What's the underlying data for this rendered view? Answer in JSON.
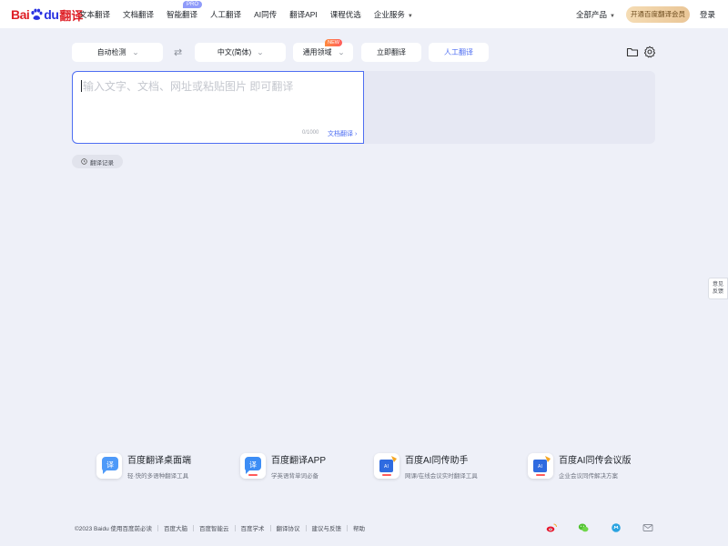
{
  "brand": {
    "bai": "Bai",
    "du": "du",
    "fanyi": "翻译"
  },
  "nav": {
    "items": [
      {
        "label": "文本翻译"
      },
      {
        "label": "文档翻译"
      },
      {
        "label": "智能翻译",
        "badge": "PRO"
      },
      {
        "label": "人工翻译"
      },
      {
        "label": "AI同传"
      },
      {
        "label": "翻译API"
      },
      {
        "label": "课程优选"
      },
      {
        "label": "企业服务"
      }
    ],
    "all_products": "全部产品",
    "vip": "开通百度翻译会员",
    "login": "登录"
  },
  "toolbar": {
    "source_lang": "自动检测",
    "target_lang": "中文(简体)",
    "domain": "通用领域",
    "domain_badge": "NEW",
    "translate": "立即翻译",
    "human": "人工翻译"
  },
  "editor": {
    "placeholder": "输入文字、文档、网址或粘贴图片 即可翻译",
    "counter": "0/1000",
    "doc_link": "文档翻译 ›"
  },
  "history": "翻译记录",
  "feedback": {
    "line1": "意见",
    "line2": "反馈"
  },
  "products": [
    {
      "name": "百度翻译桌面端",
      "desc": "轻·快的多语种翻译工具"
    },
    {
      "name": "百度翻译APP",
      "desc": "学英语背单词必备"
    },
    {
      "name": "百度AI同传助手",
      "desc": "网课/在线会议实时翻译工具"
    },
    {
      "name": "百度AI同传会议版",
      "desc": "企业会议同传解决方案"
    }
  ],
  "footer": {
    "links": [
      "©2023 Baidu  使用百度前必读",
      "百度大脑",
      "百度智能云",
      "百度学术",
      "翻译协议",
      "建议与反馈",
      "帮助"
    ]
  },
  "colors": {
    "accent": "#4e6ef2",
    "background": "#eef0f8",
    "vip_gold": "#eac697"
  }
}
